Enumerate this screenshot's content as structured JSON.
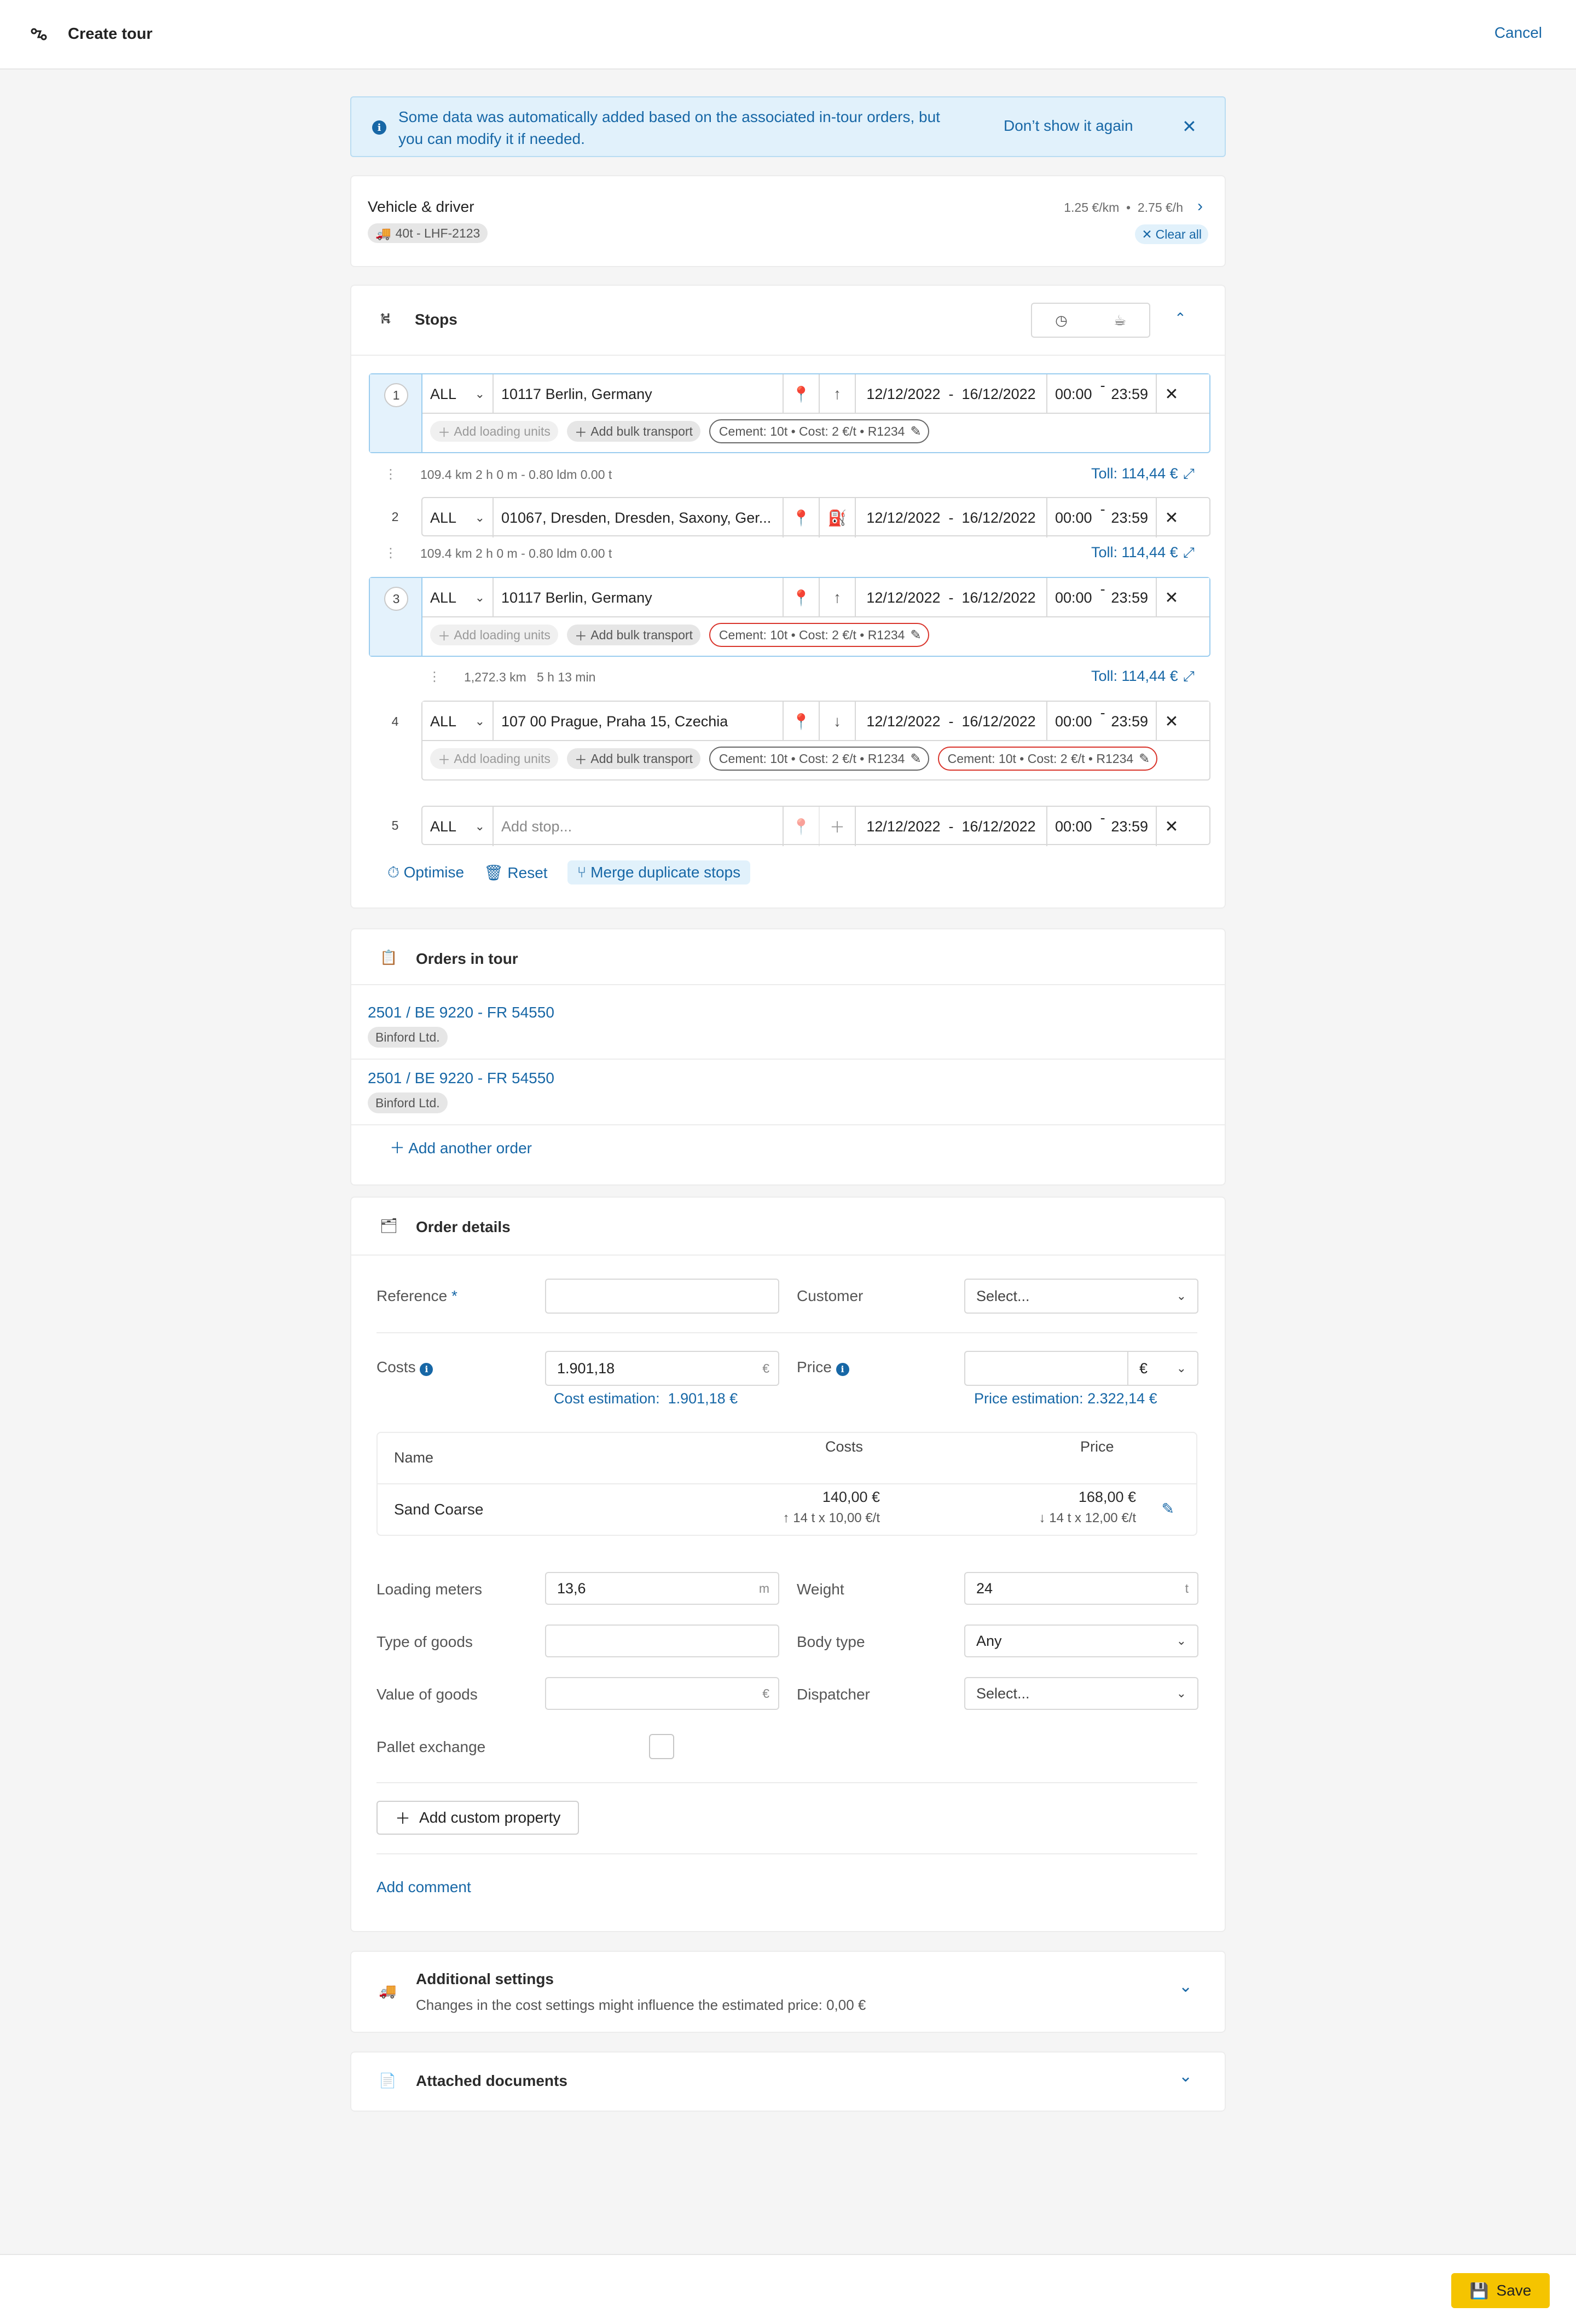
{
  "header": {
    "title": "Create tour",
    "cancel": "Cancel"
  },
  "banner": {
    "text": "Some data was automatically added based on the associated in-tour orders, but you can modify it if needed.",
    "dont_show": "Don’t show it again"
  },
  "vehicle": {
    "title": "Vehicle & driver",
    "rates": "1.25 €/km  •  2.75 €/h",
    "vehicle_chip": "40t - LHF-2123",
    "clear_all": "Clear all"
  },
  "stops": {
    "title": "Stops",
    "items": [
      {
        "num": "1",
        "type": "ALL",
        "address": "10117 Berlin, Germany",
        "dir": "up",
        "date_from": "12/12/2022",
        "date_to": "16/12/2022",
        "time_from": "00:00",
        "time_to": "23:59",
        "add_units": "Add loading units",
        "add_bulk": "Add bulk transport",
        "tags": [
          "Cement: 10t • Cost: 2 €/t • R1234"
        ]
      },
      {
        "num": "2",
        "type": "ALL",
        "address": "01067, Dresden, Dresden, Saxony, Ger...",
        "dir": "fuel",
        "date_from": "12/12/2022",
        "date_to": "16/12/2022",
        "time_from": "00:00",
        "time_to": "23:59"
      },
      {
        "num": "3",
        "type": "ALL",
        "address": "10117 Berlin, Germany",
        "dir": "up",
        "date_from": "12/12/2022",
        "date_to": "16/12/2022",
        "time_from": "00:00",
        "time_to": "23:59",
        "add_units": "Add loading units",
        "add_bulk": "Add bulk transport",
        "tags": [
          "Cement: 10t • Cost: 2 €/t • R1234"
        ]
      },
      {
        "num": "4",
        "type": "ALL",
        "address": "107 00 Prague, Praha 15, Czechia",
        "dir": "down",
        "date_from": "12/12/2022",
        "date_to": "16/12/2022",
        "time_from": "00:00",
        "time_to": "23:59",
        "add_units": "Add loading units",
        "add_bulk": "Add bulk transport",
        "tags": [
          "Cement: 10t • Cost: 2 €/t • R1234",
          "Cement: 10t • Cost: 2 €/t • R1234"
        ]
      },
      {
        "num": "5",
        "type": "ALL",
        "address_placeholder": "Add stop...",
        "date_from": "12/12/2022",
        "date_to": "16/12/2022",
        "time_from": "00:00",
        "time_to": "23:59"
      }
    ],
    "legs": [
      {
        "dist": "109.4 km 2 h 0 m - 0.80 ldm 0.00 t",
        "toll": "Toll: 114,44 €"
      },
      {
        "dist": "109.4 km 2 h 0 m - 0.80 ldm 0.00 t",
        "toll": "Toll: 114,44 €"
      },
      {
        "dist": "1,272.3 km   5 h 13 min",
        "toll": "Toll: 114,44 €"
      }
    ],
    "actions": {
      "optimise": "Optimise",
      "reset": "Reset",
      "merge": "Merge duplicate stops"
    }
  },
  "orders": {
    "title": "Orders in tour",
    "items": [
      {
        "id": "2501 / BE 9220 - FR 54550",
        "company": "Binford Ltd."
      },
      {
        "id": "2501 / BE 9220 - FR 54550",
        "company": "Binford Ltd."
      }
    ],
    "add": "Add another order"
  },
  "details": {
    "title": "Order details",
    "reference_label": "Reference",
    "required_mark": "*",
    "customer_label": "Customer",
    "customer_placeholder": "Select...",
    "costs_label": "Costs",
    "costs_value": "1.901,18",
    "costs_unit": "€",
    "price_label": "Price",
    "price_currency": "€",
    "cost_estimation": "Cost estimation:  1.901,18 €",
    "price_estimation": "Price estimation: 2.322,14 €",
    "table": {
      "col_name": "Name",
      "col_costs": "Costs",
      "col_price": "Price",
      "row": {
        "name": "Sand Coarse",
        "costs": "140,00 €",
        "costs_sub": "14 t x 10,00 €/t",
        "price": "168,00 €",
        "price_sub": "14 t x 12,00 €/t"
      }
    },
    "loading_meters_label": "Loading meters",
    "loading_meters_value": "13,6",
    "loading_meters_unit": "m",
    "weight_label": "Weight",
    "weight_value": "24",
    "weight_unit": "t",
    "type_goods_label": "Type of goods",
    "body_type_label": "Body type",
    "body_type_value": "Any",
    "value_goods_label": "Value of goods",
    "value_goods_unit": "€",
    "dispatcher_label": "Dispatcher",
    "dispatcher_placeholder": "Select...",
    "pallet_label": "Pallet exchange",
    "add_custom": "Add custom property",
    "add_comment": "Add comment"
  },
  "additional": {
    "title": "Additional settings",
    "subtitle": "Changes in the cost settings might influence the estimated price: 0,00 €"
  },
  "documents": {
    "title": "Attached documents"
  },
  "footer": {
    "save": "Save"
  },
  "colors": {
    "accent": "#1767a6",
    "save": "#f5c400",
    "warning_border": "#d9342b",
    "highlight": "#e4f2fc"
  }
}
